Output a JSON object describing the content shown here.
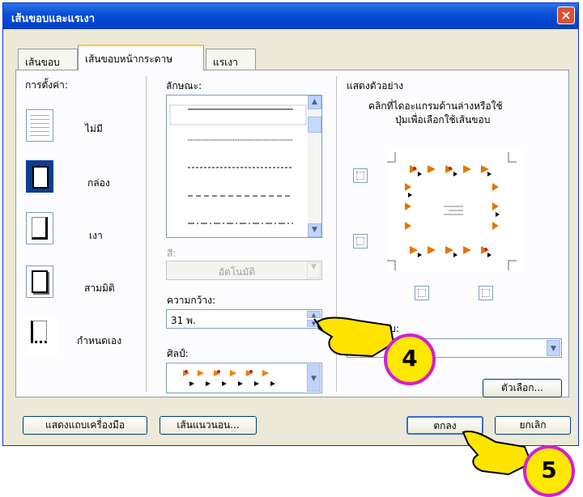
{
  "window": {
    "title": "เส้นขอบและแรเงา",
    "close": "×"
  },
  "tabs": [
    {
      "label": "เส้นขอบ"
    },
    {
      "label": "เส้นขอบหน้ากระดาษ"
    },
    {
      "label": "แรเงา"
    }
  ],
  "settings": {
    "header": "การตั้งค่า:",
    "items": [
      {
        "label": "ไม่มี"
      },
      {
        "label": "กล่อง"
      },
      {
        "label": "เงา"
      },
      {
        "label": "สามมิติ"
      },
      {
        "label": "กำหนดเอง"
      }
    ]
  },
  "style": {
    "header": "ลักษณะ:"
  },
  "color": {
    "label": "สี:",
    "value": "อัตโนมัติ"
  },
  "width": {
    "label": "ความกว้าง:",
    "value": "31 พ."
  },
  "art": {
    "label": "ศิลป์:"
  },
  "preview": {
    "header": "แสดงตัวอย่าง",
    "hint_line1": "คลิกที่ไดอะแกรมด้านล่างหรือใช้",
    "hint_line2": "ปุ่มเพื่อเลือกใช้เส้นขอบ"
  },
  "apply_to": {
    "label": "ใช้กับ:"
  },
  "buttons": {
    "options": "ตัวเลือก...",
    "show_toolbar": "แสดงแถบเครื่องมือ",
    "horizontal_line": "เส้นแนวนอน...",
    "ok": "ตกลง",
    "cancel": "ยกเลิก"
  },
  "annotations": {
    "step4": "4",
    "step5": "5"
  },
  "colors": {
    "title_bar": "#0a4fd6",
    "dialog_bg": "#ece9d8",
    "badge_fill": "#ffe800",
    "badge_border": "#d21fd2"
  }
}
